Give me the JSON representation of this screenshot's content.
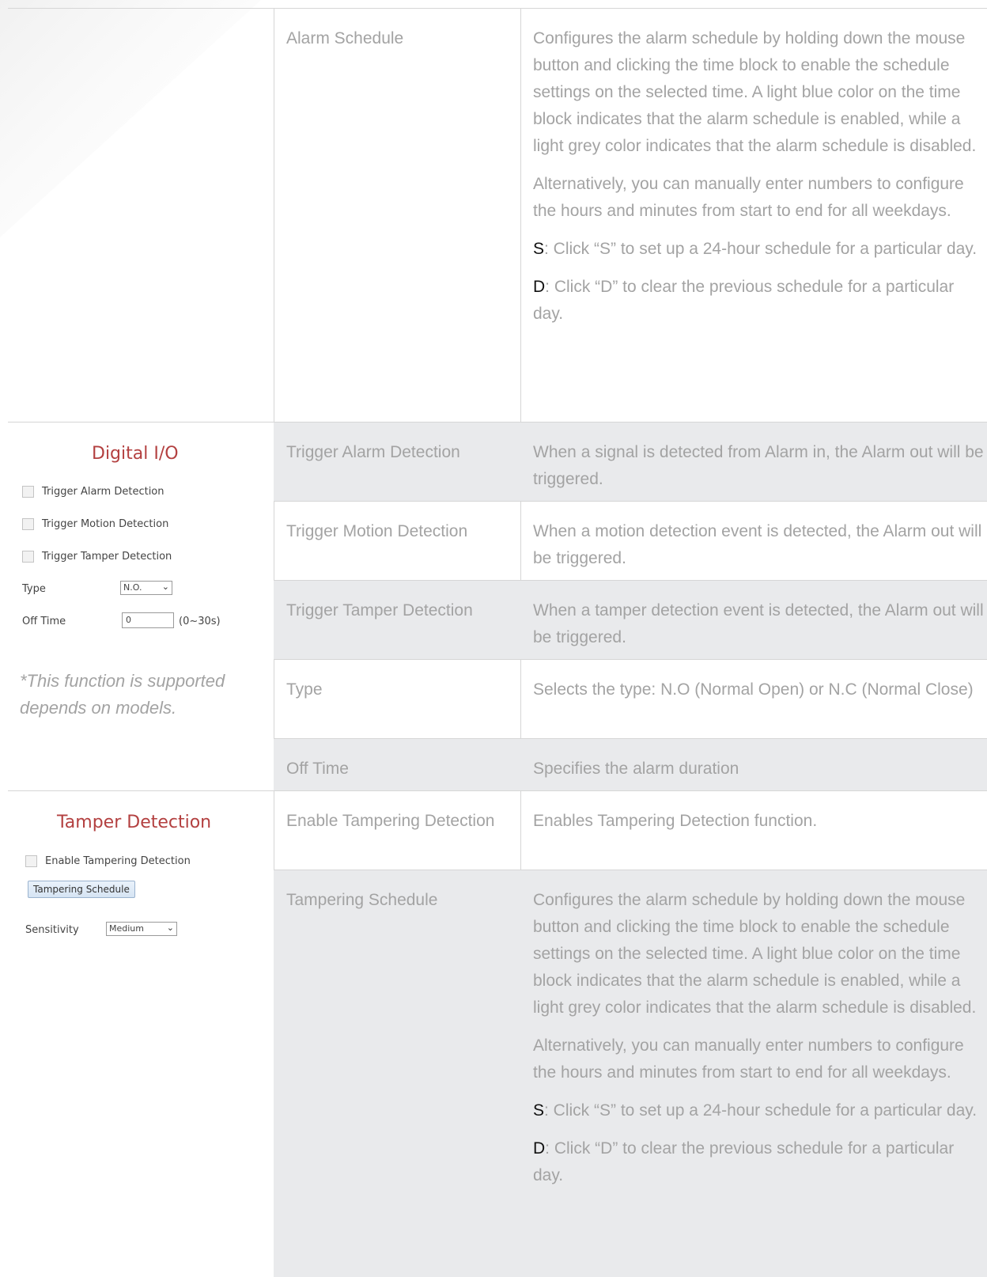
{
  "rows": [
    {
      "label": "Alarm Schedule",
      "desc": [
        "Configures the alarm schedule by holding down the mouse button and clicking the time block to enable the schedule settings on the selected time. A light blue color on the time block indicates that the alarm schedule is enabled, while a light grey color indicates that the alarm schedule is disabled.",
        "Alternatively, you can manually enter numbers to configure the hours and minutes from start to end for all weekdays."
      ],
      "s_key": "S",
      "s_text": ": Click “S” to set up a 24-hour schedule for a particular day.",
      "d_key": "D",
      "d_text": ": Click “D” to clear the previous schedule for a particular day."
    },
    {
      "label": "Trigger Alarm Detection",
      "desc": "When a signal is detected from Alarm in, the Alarm out will be triggered."
    },
    {
      "label": "Trigger Motion Detection",
      "desc": "When a motion detection event is detected, the Alarm out will be triggered."
    },
    {
      "label": "Trigger Tamper Detection",
      "desc": "When a tamper detection event is detected, the Alarm out will be triggered."
    },
    {
      "label": "Type",
      "desc": "Selects the type: N.O (Normal Open) or N.C (Normal Close)"
    },
    {
      "label": "Off Time",
      "desc": "Specifies the alarm duration"
    },
    {
      "label": "Enable Tampering Detection",
      "desc": "Enables Tampering Detection function."
    },
    {
      "label": "Tampering Schedule",
      "desc": [
        "Configures the alarm schedule by holding down the mouse button and clicking the time block to enable the schedule settings on the selected time. A light blue color on the time block indicates that the alarm schedule is enabled, while a light grey color indicates that the alarm schedule is disabled.",
        "Alternatively, you can manually enter numbers to configure the hours and minutes from start to end for all weekdays."
      ],
      "s_key": "S",
      "s_text": ": Click “S” to set up a 24-hour schedule for a particular day.",
      "d_key": "D",
      "d_text": ": Click “D” to clear the previous schedule for a particular day."
    }
  ],
  "digital_io": {
    "title": "Digital I/O",
    "checkboxes": [
      "Trigger Alarm Detection",
      "Trigger Motion Detection",
      "Trigger Tamper Detection"
    ],
    "type_label": "Type",
    "type_value": "N.O.",
    "off_time_label": "Off Time",
    "off_time_value": "0",
    "off_time_range": "(0~30s)",
    "note": "*This function is supported depends on models."
  },
  "tamper": {
    "title": "Tamper Detection",
    "checkbox": "Enable Tampering Detection",
    "button": "Tampering Schedule",
    "sensitivity_label": "Sensitivity",
    "sensitivity_value": "Medium"
  },
  "colors": {
    "text": "#a3a3a3",
    "shaded_row": "#e9eaec",
    "panel_title": "#b34040",
    "key": "#111111"
  }
}
